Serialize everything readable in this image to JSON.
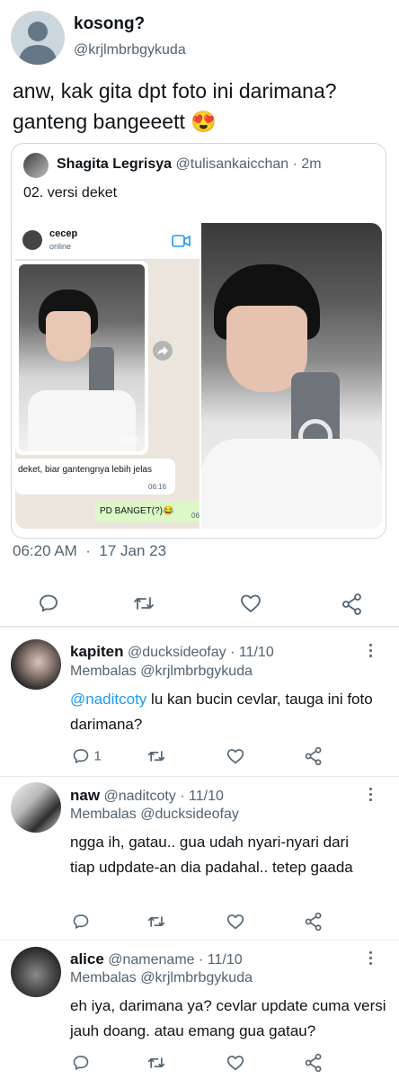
{
  "main_tweet": {
    "display_name": "kosong?",
    "handle": "@krjlmbrbgykuda",
    "text": "anw, kak gita dpt foto ini darimana? ganteng bangeeett",
    "emoji": "😍",
    "time": "06:20 AM",
    "date_sep": "·",
    "date": "17 Jan 23"
  },
  "quoted": {
    "display_name": "Shagita Legrisya",
    "handle": "@tulisankaicchan",
    "time_sep": "·",
    "time": "2m",
    "text": "02. versi deket",
    "chat": {
      "contact_name": "cecep",
      "status": "online",
      "photo_time": "06:16",
      "message": "deket, biar gantengnya lebih jelas",
      "message_time": "06:16",
      "reply": "PD BANGET(?)😂",
      "reply_time_partial": "06"
    }
  },
  "replies": [
    {
      "display_name": "kapiten",
      "handle": "@ducksideofay",
      "sep": "·",
      "date": "11/10",
      "replying_prefix": "Membalas",
      "replying_to": "@krjlmbrbgykuda",
      "mention": "@naditcoty",
      "text": " lu kan bucin cevlar, tauga ini foto darimana?",
      "reply_count": "1"
    },
    {
      "display_name": "naw",
      "handle": "@naditcoty",
      "sep": "·",
      "date": "11/10",
      "replying_prefix": "Membalas",
      "replying_to": "@ducksideofay",
      "text": "ngga ih, gatau.. gua udah nyari-nyari dari tiap udpdate-an dia padahal.. tetep gaada"
    },
    {
      "display_name": "alice",
      "handle": "@namename",
      "sep": "·",
      "date": "11/10",
      "replying_prefix": "Membalas",
      "replying_to": "@krjlmbrbgykuda",
      "text": "eh iya, darimana ya? cevlar update cuma versi jauh doang. atau emang gua gatau?"
    }
  ],
  "colors": {
    "accent": "#1d9bf0",
    "text": "#0f1419",
    "muted": "#536471",
    "whatsapp_green": "#dcf8c6"
  },
  "icons": [
    "avatar-placeholder-icon",
    "reply-icon",
    "retweet-icon",
    "like-icon",
    "share-icon",
    "more-icon",
    "video-call-icon",
    "forward-icon"
  ]
}
